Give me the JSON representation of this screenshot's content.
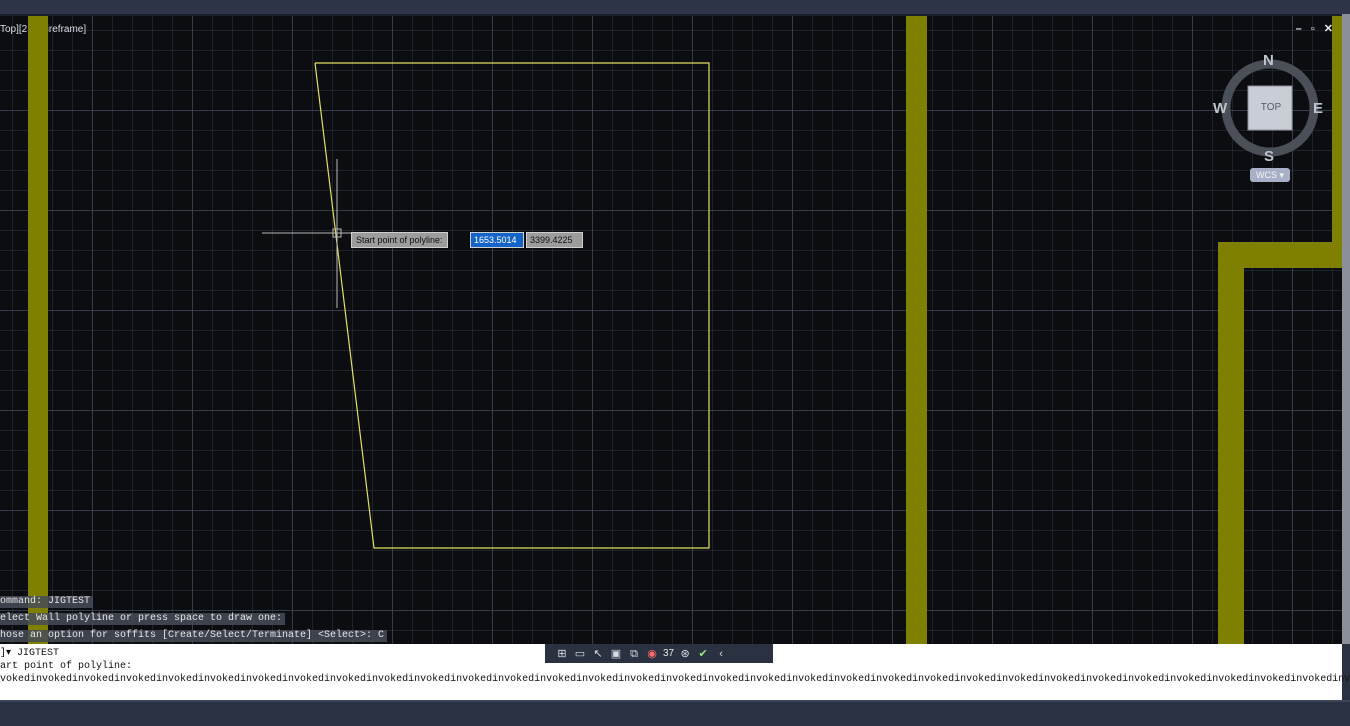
{
  "viewport": {
    "label": "Top][2D Wireframe]",
    "controls": "– ▫ ✕"
  },
  "viewcube": {
    "north": "N",
    "south": "S",
    "east": "E",
    "west": "W",
    "face": "TOP",
    "wcs": "WCS ▾"
  },
  "jig": {
    "prompt": "Start point of polyline:",
    "x_value": "1653.5014",
    "y_value": "3399.4225"
  },
  "command_history": {
    "line1": "ommand:  JIGTEST",
    "line2": "elect Wall polyline or press space to draw one:",
    "line3": "hose an option for soffits [Create/Select/Terminate] <Select>: C"
  },
  "command_line": {
    "line1": "]▾ JIGTEST",
    "line2": "art point of polyline:",
    "line3": "vokedinvokedinvokedinvokedinvokedinvokedinvokedinvokedinvokedinvokedinvokedinvokedinvokedinvokedinvokedinvokedinvokedinvokedinvokedinvokedinvokedinvokedinvokedinvokedinvokedinvokedinvokedinvokedinvokedinvokedinvokedinvokedinvokedinvoked"
  },
  "statusbar": {
    "annotation_count": "37"
  },
  "colors": {
    "viewport_bg": "#0b0d10",
    "wall": "#7f7f00",
    "polyline": "#e0e060",
    "jig_highlight": "#1463c8"
  }
}
